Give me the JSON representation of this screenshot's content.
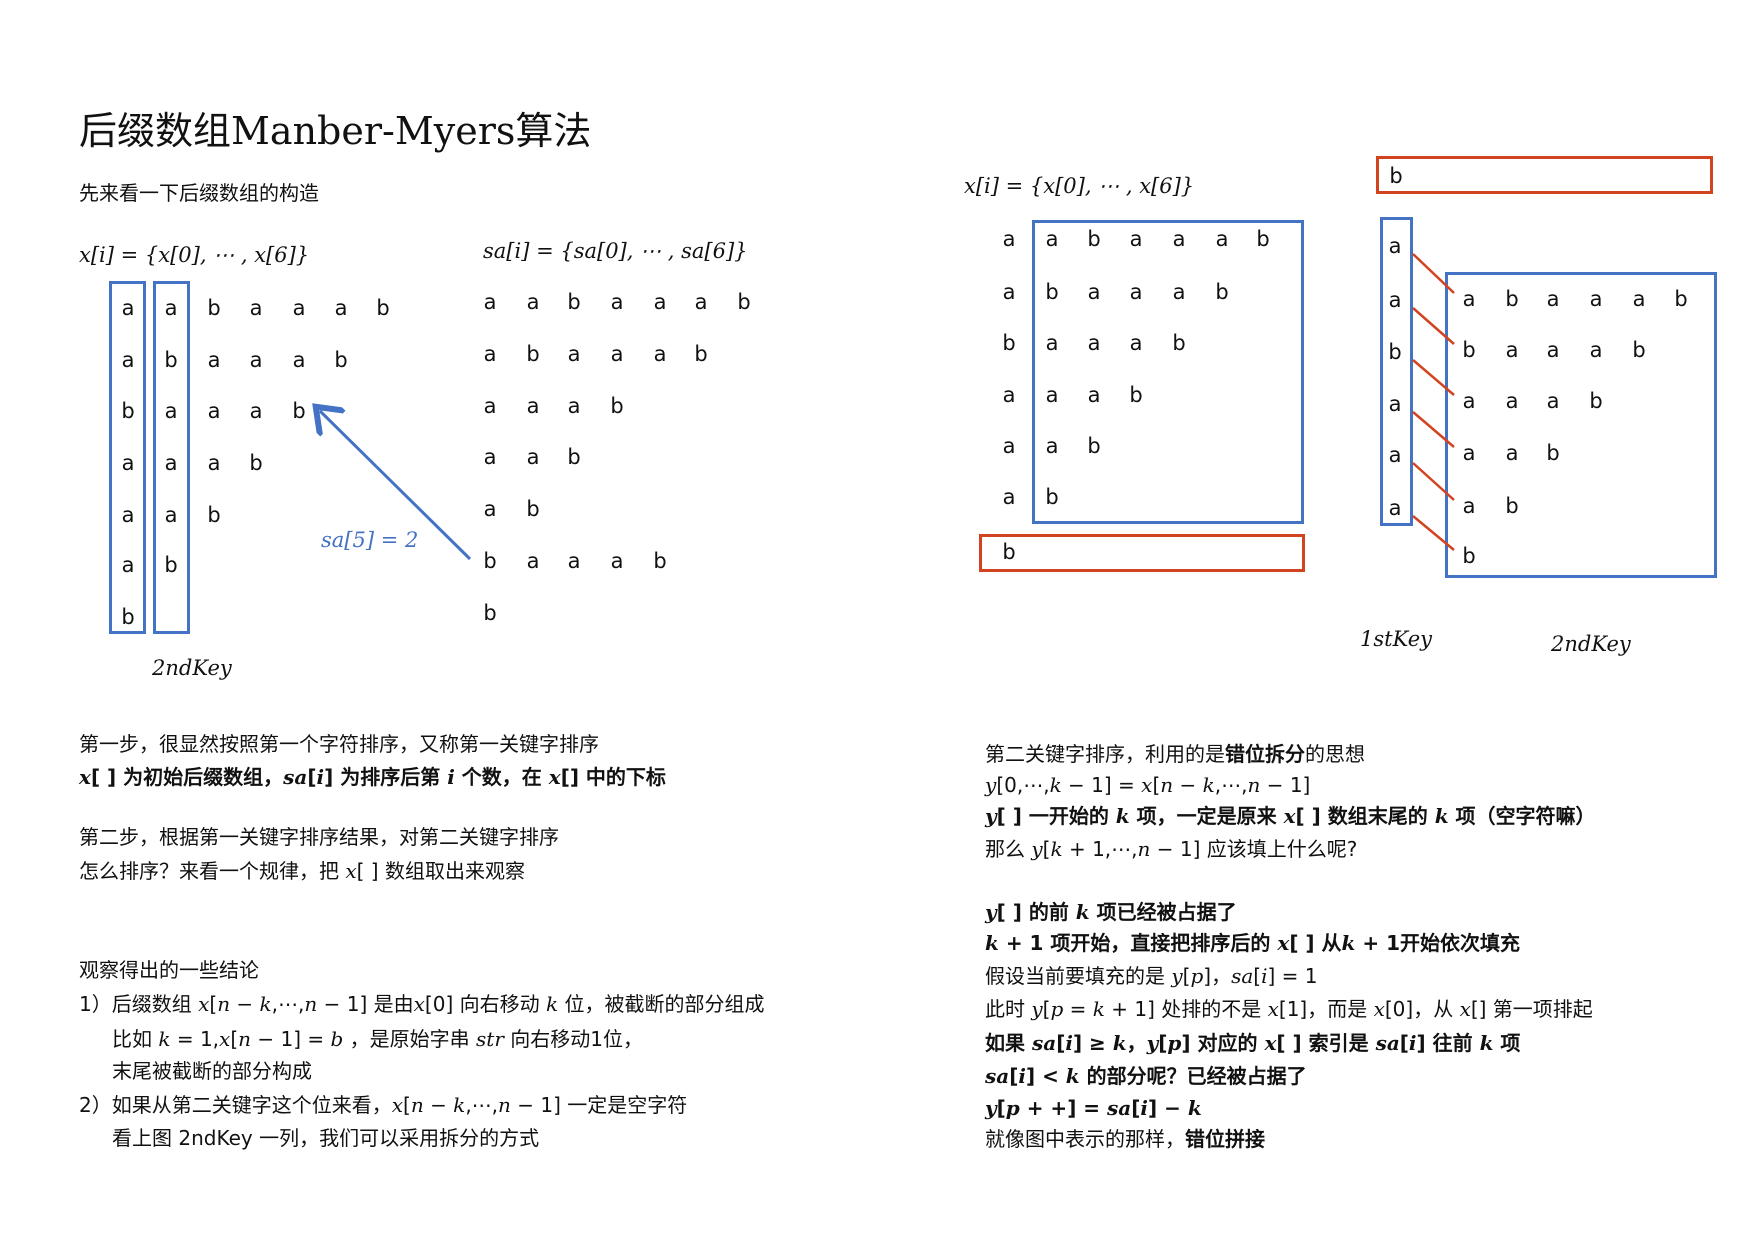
{
  "title": "后缀数组Manber-Myers算法",
  "subtitle": "先来看一下后缀数组的构造",
  "colors": {
    "blue": "#4472c4",
    "red": "#d2431f"
  },
  "left_diagram": {
    "x_formula": "x[i] = {x[0], ⋯ , x[6]}",
    "sa_formula": "sa[i] = {sa[0], ⋯ , sa[6]}",
    "x_rows": [
      "aabaaab",
      "abaaab",
      "baaab",
      "aaab",
      "aab",
      "ab",
      "b"
    ],
    "sa_rows": [
      "aabaaab",
      "abaaab",
      "aaab",
      "aab",
      "ab",
      "baaab",
      "b"
    ],
    "arrow_label": "sa[5] = 2",
    "key_label": "2ndKey"
  },
  "right_diagram": {
    "x_formula": "x[i] = {x[0], ⋯ , x[6]}",
    "rows": [
      "aabaaab",
      "abaaab",
      "baaab",
      "aaab",
      "aab",
      "ab"
    ],
    "bottom_cell": "b",
    "top_cell": "b",
    "first_key": [
      "a",
      "a",
      "b",
      "a",
      "a",
      "a"
    ],
    "second_key_rows": [
      "abaaab",
      "baaab",
      "aaab",
      "aab",
      "ab",
      "b"
    ],
    "first_key_label": "1stKey",
    "second_key_label": "2ndKey"
  },
  "left_text": [
    [
      {
        "t": "第一步，很显然按照第一个字符排序，又称第一关键字排序"
      }
    ],
    [
      {
        "t": "x",
        "s": "mb"
      },
      {
        "t": "[ ] ",
        "s": "b"
      },
      {
        "t": "为初始后缀数组，",
        "s": "b"
      },
      {
        "t": "sa",
        "s": "mb"
      },
      {
        "t": "[",
        "s": "b"
      },
      {
        "t": "i",
        "s": "mb"
      },
      {
        "t": "] 为排序后第 ",
        "s": "b"
      },
      {
        "t": "i",
        "s": "mb"
      },
      {
        "t": " 个数，在 ",
        "s": "b"
      },
      {
        "t": "x",
        "s": "mb"
      },
      {
        "t": "[] 中的下标",
        "s": "b"
      }
    ],
    [
      {
        "t": "第二步，根据第一关键字排序结果，对第二关键字排序"
      }
    ],
    [
      {
        "t": "怎么排序？来看一个规律，把 "
      },
      {
        "t": "x",
        "s": "m"
      },
      {
        "t": "[ ] 数组取出来观察"
      }
    ]
  ],
  "conclusions": [
    [
      {
        "t": "观察得出的一些结论"
      }
    ],
    [
      {
        "t": "1）后缀数组 "
      },
      {
        "t": "x",
        "s": "m"
      },
      {
        "t": "["
      },
      {
        "t": "n − k",
        "s": "m"
      },
      {
        "t": ",⋯,"
      },
      {
        "t": "n",
        "s": "m"
      },
      {
        "t": " − 1] 是由"
      },
      {
        "t": "x",
        "s": "m"
      },
      {
        "t": "[0] 向右移动 "
      },
      {
        "t": "k",
        "s": "m"
      },
      {
        "t": " 位，被截断的部分组成"
      }
    ],
    [
      {
        "t": "比如 "
      },
      {
        "t": "k",
        "s": "m"
      },
      {
        "t": " = 1,"
      },
      {
        "t": "x",
        "s": "m"
      },
      {
        "t": "["
      },
      {
        "t": "n",
        "s": "m"
      },
      {
        "t": " − 1] = "
      },
      {
        "t": "b",
        "s": "m"
      },
      {
        "t": " ，是原始字串 "
      },
      {
        "t": "str",
        "s": "m"
      },
      {
        "t": " 向右移动1位，"
      }
    ],
    [
      {
        "t": "末尾被截断的部分构成"
      }
    ],
    [
      {
        "t": "2）如果从第二关键字这个位来看，"
      },
      {
        "t": "x",
        "s": "m"
      },
      {
        "t": "["
      },
      {
        "t": "n − k",
        "s": "m"
      },
      {
        "t": ",⋯,"
      },
      {
        "t": "n",
        "s": "m"
      },
      {
        "t": " − 1] 一定是空字符"
      }
    ],
    [
      {
        "t": "看上图 2ndKey 一列，我们可以采用拆分的方式"
      }
    ]
  ],
  "right_text": [
    [
      {
        "t": "第二关键字排序，利用的是"
      },
      {
        "t": "错位拆分",
        "s": "b"
      },
      {
        "t": "的思想"
      }
    ],
    [
      {
        "t": "y",
        "s": "m"
      },
      {
        "t": "[0,⋯,"
      },
      {
        "t": "k",
        "s": "m"
      },
      {
        "t": " − 1] = "
      },
      {
        "t": "x",
        "s": "m"
      },
      {
        "t": "["
      },
      {
        "t": "n − k",
        "s": "m"
      },
      {
        "t": ",⋯,"
      },
      {
        "t": "n",
        "s": "m"
      },
      {
        "t": " − 1]"
      }
    ],
    [
      {
        "t": "y",
        "s": "mb"
      },
      {
        "t": "[ ] 一开始的 ",
        "s": "b"
      },
      {
        "t": "k",
        "s": "mb"
      },
      {
        "t": " 项，一定是原来 ",
        "s": "b"
      },
      {
        "t": "x",
        "s": "mb"
      },
      {
        "t": "[ ] 数组末尾的 ",
        "s": "b"
      },
      {
        "t": "k",
        "s": "mb"
      },
      {
        "t": " 项（空字符嘛）",
        "s": "b"
      }
    ],
    [
      {
        "t": "那么 "
      },
      {
        "t": "y",
        "s": "m"
      },
      {
        "t": "["
      },
      {
        "t": "k",
        "s": "m"
      },
      {
        "t": " + 1,⋯,"
      },
      {
        "t": "n",
        "s": "m"
      },
      {
        "t": " − 1] 应该填上什么呢?"
      }
    ],
    [
      {
        "t": "y",
        "s": "mb"
      },
      {
        "t": "[ ] 的前 ",
        "s": "b"
      },
      {
        "t": "k",
        "s": "mb"
      },
      {
        "t": " 项已经被占据了",
        "s": "b"
      }
    ],
    [
      {
        "t": "k",
        "s": "mb"
      },
      {
        "t": " + 1 项开始，直接把排序后的 ",
        "s": "b"
      },
      {
        "t": "x",
        "s": "mb"
      },
      {
        "t": "[ ] 从",
        "s": "b"
      },
      {
        "t": "k",
        "s": "mb"
      },
      {
        "t": " + 1开始依次填充",
        "s": "b"
      }
    ],
    [
      {
        "t": "假设当前要填充的是 "
      },
      {
        "t": "y",
        "s": "m"
      },
      {
        "t": "["
      },
      {
        "t": "p",
        "s": "m"
      },
      {
        "t": "]，"
      },
      {
        "t": "sa",
        "s": "m"
      },
      {
        "t": "["
      },
      {
        "t": "i",
        "s": "m"
      },
      {
        "t": "] = 1"
      }
    ],
    [
      {
        "t": "此时 "
      },
      {
        "t": "y",
        "s": "m"
      },
      {
        "t": "["
      },
      {
        "t": "p",
        "s": "m"
      },
      {
        "t": " = "
      },
      {
        "t": "k",
        "s": "m"
      },
      {
        "t": " + 1] 处排的不是 "
      },
      {
        "t": "x",
        "s": "m"
      },
      {
        "t": "[1]，而是 "
      },
      {
        "t": "x",
        "s": "m"
      },
      {
        "t": "[0]，从 "
      },
      {
        "t": "x",
        "s": "m"
      },
      {
        "t": "[] 第一项排起"
      }
    ],
    [
      {
        "t": "如果 ",
        "s": "b"
      },
      {
        "t": "sa",
        "s": "mb"
      },
      {
        "t": "[",
        "s": "b"
      },
      {
        "t": "i",
        "s": "mb"
      },
      {
        "t": "] ≥ ",
        "s": "b"
      },
      {
        "t": "k",
        "s": "mb"
      },
      {
        "t": "，",
        "s": "b"
      },
      {
        "t": "y",
        "s": "mb"
      },
      {
        "t": "[",
        "s": "b"
      },
      {
        "t": "p",
        "s": "mb"
      },
      {
        "t": "] 对应的 ",
        "s": "b"
      },
      {
        "t": "x",
        "s": "mb"
      },
      {
        "t": "[ ] 索引是 ",
        "s": "b"
      },
      {
        "t": "sa",
        "s": "mb"
      },
      {
        "t": "[",
        "s": "b"
      },
      {
        "t": "i",
        "s": "mb"
      },
      {
        "t": "] 往前 ",
        "s": "b"
      },
      {
        "t": "k",
        "s": "mb"
      },
      {
        "t": " 项",
        "s": "b"
      }
    ],
    [
      {
        "t": "sa",
        "s": "mb"
      },
      {
        "t": "[",
        "s": "b"
      },
      {
        "t": "i",
        "s": "mb"
      },
      {
        "t": "] < ",
        "s": "b"
      },
      {
        "t": "k",
        "s": "mb"
      },
      {
        "t": " 的部分呢？已经被占据了",
        "s": "b"
      }
    ],
    [
      {
        "t": "y",
        "s": "mb"
      },
      {
        "t": "[",
        "s": "b"
      },
      {
        "t": "p",
        "s": "mb"
      },
      {
        "t": " + +] = ",
        "s": "b"
      },
      {
        "t": "sa",
        "s": "mb"
      },
      {
        "t": "[",
        "s": "b"
      },
      {
        "t": "i",
        "s": "mb"
      },
      {
        "t": "] − ",
        "s": "b"
      },
      {
        "t": "k",
        "s": "mb"
      }
    ],
    [
      {
        "t": "就像图中表示的那样，"
      },
      {
        "t": "错位拼接",
        "s": "b"
      }
    ]
  ]
}
